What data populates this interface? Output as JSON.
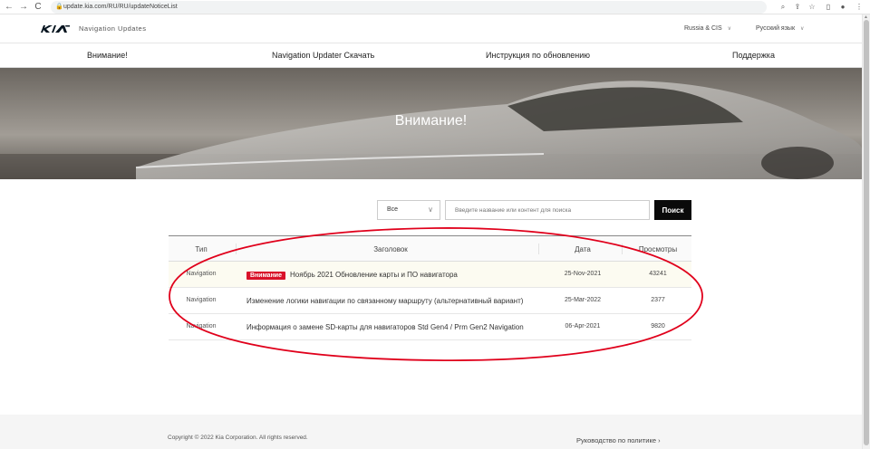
{
  "browser": {
    "url": "update.kia.com/RU/RU/updateNoticeList",
    "back_glyph": "←",
    "forward_glyph": "→",
    "reload_glyph": "C",
    "icons": [
      "zoom-icon",
      "share-icon",
      "star-icon",
      "sidebar-icon",
      "profile-icon",
      "menu-icon"
    ]
  },
  "header": {
    "brand": "KIA",
    "subtitle": "Navigation Updates",
    "region": "Russia & CIS",
    "language": "Русский язык"
  },
  "menu": {
    "items": [
      "Внимание!",
      "Navigation Updater Скачать",
      "Инструкция по обновлению",
      "Поддержка"
    ]
  },
  "hero": {
    "title": "Внимание!"
  },
  "search": {
    "category": "Все",
    "placeholder": "Введите название или контент для поиска",
    "button": "Поиск"
  },
  "table": {
    "headers": [
      "Тип",
      "Заголовок",
      "Дата",
      "Просмотры"
    ],
    "rows": [
      {
        "type": "Navigation",
        "badge": "Внимание",
        "title": "Ноябрь 2021 Обновление карты и ПО навигатора",
        "date": "25-Nov-2021",
        "views": "43241"
      },
      {
        "type": "Navigation",
        "badge": "",
        "title": "Изменение логики навигации по связанному маршруту (альтернативный вариант)",
        "date": "25-Mar-2022",
        "views": "2377"
      },
      {
        "type": "Navigation",
        "badge": "",
        "title": "Информация о замене SD-карты для навигаторов Std Gen4 / Prm Gen2 Navigation",
        "date": "06-Apr-2021",
        "views": "9820"
      }
    ]
  },
  "footer": {
    "copyright": "Copyright © 2022 Kia Corporation. All rights reserved.",
    "policy": "Руководство по политике ›"
  },
  "colors": {
    "accent_red": "#d9122a",
    "annotation_red": "#e0001b",
    "search_button": "#0a0a0a"
  }
}
